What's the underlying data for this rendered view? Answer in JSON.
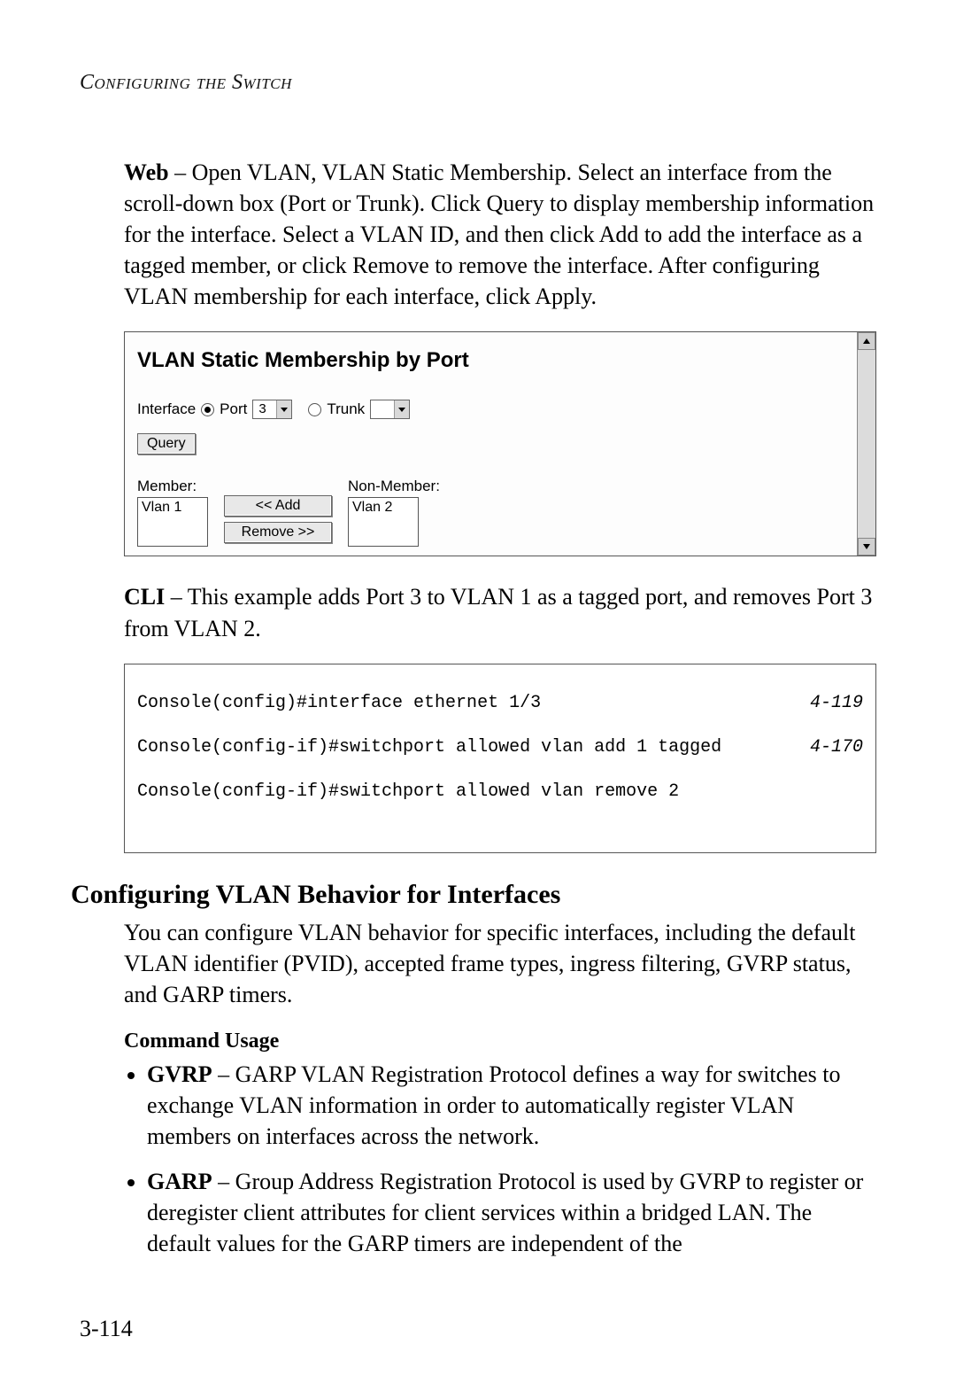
{
  "running_head": "Configuring the Switch",
  "para_web": {
    "lead": "Web",
    "text": " – Open VLAN, VLAN Static Membership. Select an interface from the scroll-down box (Port or Trunk). Click Query to display membership information for the interface. Select a VLAN ID, and then click Add to add the interface as a tagged member, or click Remove to remove the interface. After configuring VLAN membership for each interface, click Apply."
  },
  "panel": {
    "title": "VLAN Static Membership by Port",
    "interface_label": "Interface",
    "port_label": "Port",
    "port_value": "3",
    "trunk_label": "Trunk",
    "trunk_value": "",
    "query_btn": "Query",
    "member_label": "Member:",
    "member_item": "Vlan 1",
    "nonmember_label": "Non-Member:",
    "nonmember_item": "Vlan 2",
    "add_btn": "<< Add",
    "remove_btn": "Remove >>"
  },
  "para_cli": {
    "lead": "CLI",
    "text": " – This example adds Port 3 to VLAN 1 as a tagged port, and removes Port 3 from VLAN 2."
  },
  "cli": {
    "line1": "Console(config)#interface ethernet 1/3",
    "ref1": "4-119",
    "line2": "Console(config-if)#switchport allowed vlan add 1 tagged",
    "ref2": "4-170",
    "line3": "Console(config-if)#switchport allowed vlan remove 2"
  },
  "section_heading": "Configuring VLAN Behavior for Interfaces",
  "para_beh": "You can configure VLAN behavior for specific interfaces, including the default VLAN identifier (PVID), accepted frame types, ingress filtering, GVRP status, and GARP timers.",
  "cmd_usage": "Command Usage",
  "bullets": [
    {
      "lead": "GVRP",
      "text": " – GARP VLAN Registration Protocol defines a way for switches to exchange VLAN information in order to automatically register VLAN members on interfaces across the network."
    },
    {
      "lead": "GARP",
      "text": " – Group Address Registration Protocol is used by GVRP to register or deregister client attributes for client services within a bridged LAN. The default values for the GARP timers are independent of the"
    }
  ],
  "page_number": "3-114"
}
